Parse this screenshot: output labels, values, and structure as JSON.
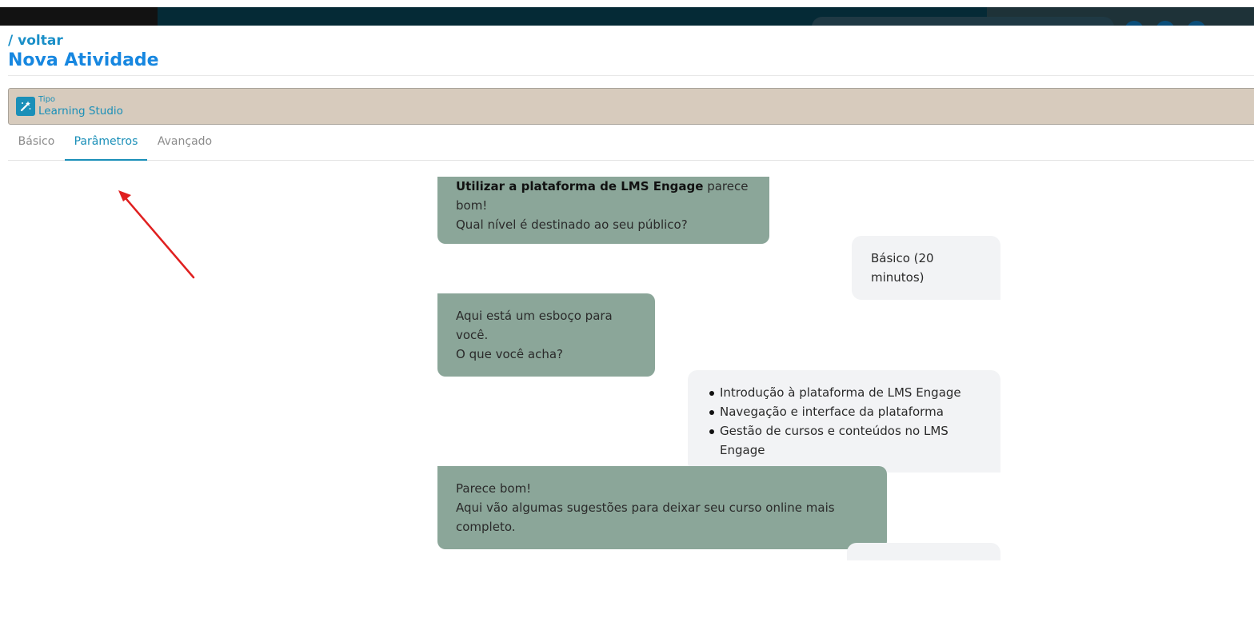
{
  "header": {
    "back_label": "/ voltar",
    "title": "Nova Atividade"
  },
  "type_bar": {
    "label": "Tipo",
    "value": "Learning Studio",
    "icon": "magic-wand-icon",
    "background": "#d7cbbd",
    "accent": "#1a8fb8"
  },
  "tabs": [
    {
      "label": "Básico",
      "active": false
    },
    {
      "label": "Parâmetros",
      "active": true
    },
    {
      "label": "Avançado",
      "active": false
    }
  ],
  "annotation": {
    "icon": "red-arrow-icon",
    "color": "#e02020"
  },
  "chat": {
    "messages": [
      {
        "role": "bot",
        "bold": "Utilizar a plataforma de LMS Engage",
        "text": " parece bom!",
        "line2": "Qual nível é destinado ao seu público?"
      },
      {
        "role": "user",
        "text": "Básico (20 minutos)"
      },
      {
        "role": "bot",
        "line1": "Aqui está um esboço para você.",
        "line2": "O que você acha?"
      },
      {
        "role": "user",
        "items": [
          "Introdução à plataforma de LMS Engage",
          "Navegação e interface da plataforma",
          "Gestão de cursos e conteúdos no LMS Engage"
        ]
      },
      {
        "role": "bot",
        "line1": "Parece bom!",
        "line2": "Aqui vão algumas sugestões para deixar seu curso online mais completo."
      }
    ],
    "bot_color": "#8ba699",
    "user_color": "#f2f3f5"
  }
}
